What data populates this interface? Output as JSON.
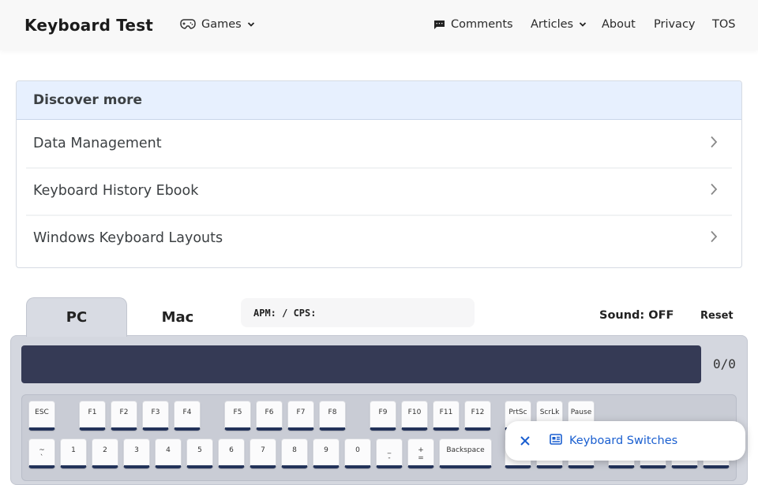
{
  "header": {
    "brand": "Keyboard Test",
    "nav": {
      "games": "Games",
      "comments": "Comments",
      "articles": "Articles",
      "about": "About",
      "privacy": "Privacy",
      "tos": "TOS"
    }
  },
  "discover": {
    "title": "Discover more",
    "items": [
      "Data Management",
      "Keyboard History Ebook",
      "Windows Keyboard Layouts"
    ]
  },
  "tabs": {
    "pc": "PC",
    "mac": "Mac",
    "active": "PC"
  },
  "stats": {
    "label": "APM: / CPS:"
  },
  "sound": "Sound: OFF",
  "reset": "Reset",
  "counter": "0/0",
  "keys": {
    "row1": [
      "ESC",
      "F1",
      "F2",
      "F3",
      "F4",
      "F5",
      "F6",
      "F7",
      "F8",
      "F9",
      "F10",
      "F11",
      "F12",
      "PrtSc",
      "ScrLk",
      "Pause"
    ],
    "row2": [
      "1",
      "2",
      "3",
      "4",
      "5",
      "6",
      "7",
      "8",
      "9",
      "0",
      "Backspace"
    ],
    "tilde_top": "~",
    "tilde_bottom": "`",
    "minus_top": "_",
    "minus_bottom": "-",
    "plus_top": "+",
    "plus_bottom": "="
  },
  "chip": {
    "label": "Keyboard Switches"
  },
  "colors": {
    "accent": "#1a5fd0",
    "display": "#353a55",
    "key_edge": "#23335a",
    "discover_head": "#e7f0fe"
  }
}
